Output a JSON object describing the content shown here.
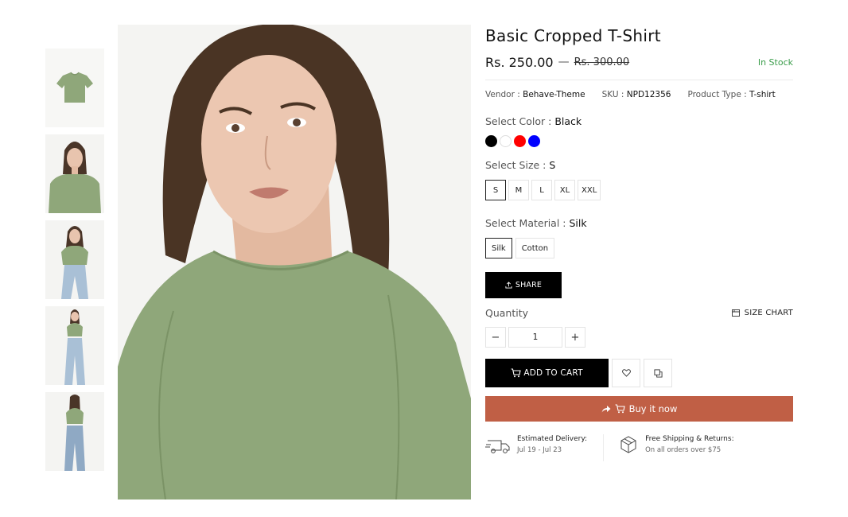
{
  "product": {
    "title": "Basic Cropped T-Shirt",
    "price": "Rs. 250.00",
    "price_separator": "—",
    "compare_price": "Rs. 300.00",
    "stock_status": "In Stock",
    "stock_color": "#3a9c4a"
  },
  "meta": {
    "vendor_label": "Vendor :",
    "vendor_value": "Behave-Theme",
    "sku_label": "SKU :",
    "sku_value": "NPD12356",
    "type_label": "Product Type :",
    "type_value": "T-shirt"
  },
  "color_option": {
    "label": "Select Color :",
    "selected": "Black",
    "swatches": [
      "#000000",
      "#ffffff",
      "#ff0000",
      "#0000ff"
    ]
  },
  "size_option": {
    "label": "Select Size :",
    "selected": "S",
    "values": [
      "S",
      "M",
      "L",
      "XL",
      "XXL"
    ]
  },
  "material_option": {
    "label": "Select Material :",
    "selected": "Silk",
    "values": [
      "Silk",
      "Cotton"
    ]
  },
  "actions": {
    "share_label": "SHARE",
    "share_icon": "share-upload-icon",
    "quantity_label": "Quantity",
    "size_chart_label": "SIZE CHART",
    "size_chart_icon": "hanger-icon",
    "qty_minus": "−",
    "qty_value": "1",
    "qty_plus": "+",
    "add_to_cart_label": "ADD TO CART",
    "cart_icon": "cart-icon",
    "wishlist_icon": "heart-icon",
    "compare_icon": "compare-icon",
    "buy_now_label": "Buy it now",
    "buy_now_color": "#c05f45"
  },
  "delivery": {
    "estimated_title": "Estimated Delivery:",
    "estimated_dates": "Jul 19 - Jul 23",
    "estimated_icon": "truck-icon",
    "shipping_title": "Free Shipping & Returns:",
    "shipping_sub": "On all orders over $75",
    "shipping_icon": "package-icon"
  },
  "gallery": {
    "shirt_color": "#8fa77a",
    "thumbnails": [
      "shirt-flat",
      "model-front-crop",
      "model-pose",
      "model-full-jeans",
      "model-back-full"
    ]
  }
}
